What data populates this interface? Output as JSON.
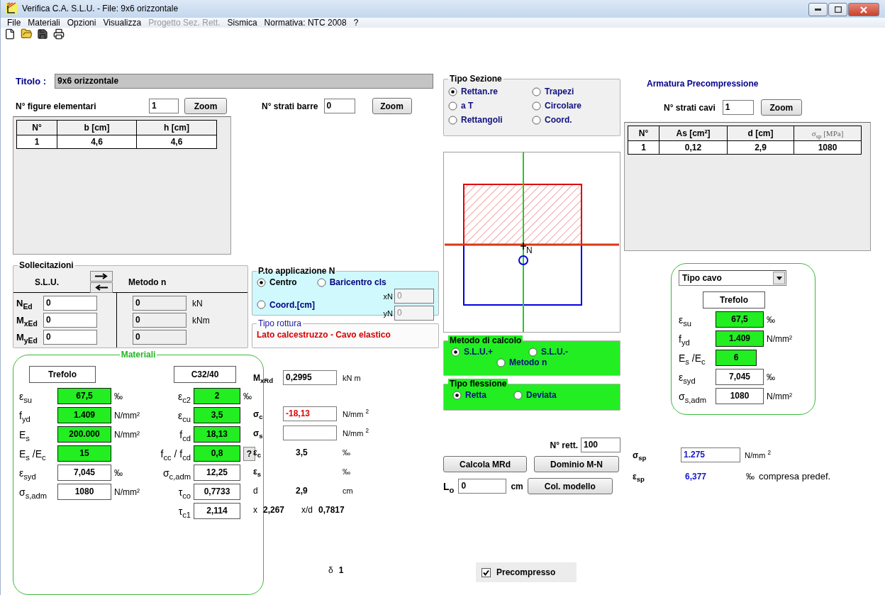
{
  "window": {
    "title": "Verifica C.A. S.L.U. - File: 9x6 orizzontale"
  },
  "menu": [
    {
      "label": "File",
      "disabled": false
    },
    {
      "label": "Materiali",
      "disabled": false
    },
    {
      "label": "Opzioni",
      "disabled": false
    },
    {
      "label": "Visualizza",
      "disabled": false
    },
    {
      "label": "Progetto Sez. Rett.",
      "disabled": true
    },
    {
      "label": "Sismica",
      "disabled": false
    },
    {
      "label": "Normativa: NTC 2008",
      "disabled": false
    },
    {
      "label": "?",
      "disabled": false
    }
  ],
  "titolo": {
    "label": "Titolo :",
    "value": "9x6 orizzontale"
  },
  "figures": {
    "label": "N° figure elementari",
    "value": "1",
    "button": "Zoom",
    "columns": [
      "N°",
      "b [cm]",
      "h [cm]"
    ],
    "rows": [
      [
        "1",
        "4,6",
        "4,6"
      ]
    ]
  },
  "bars": {
    "label": "N° strati barre",
    "value": "0",
    "button": "Zoom"
  },
  "section_type": {
    "title": "Tipo Sezione",
    "options": [
      {
        "label": "Rettan.re",
        "selected": true
      },
      {
        "label": "Trapezi",
        "selected": false
      },
      {
        "label": "a T",
        "selected": false
      },
      {
        "label": "Circolare",
        "selected": false
      },
      {
        "label": "Rettangoli",
        "selected": false
      },
      {
        "label": "Coord.",
        "selected": false
      }
    ]
  },
  "section_drawing": {
    "point_label": "N"
  },
  "prestress": {
    "title": "Armatura Precompressione",
    "label": "N° strati cavi",
    "value": "1",
    "button": "Zoom",
    "columns": [
      "N°",
      "As [cm²]",
      "d [cm]",
      "σ$_{sp}$ [MPa]"
    ],
    "rows": [
      [
        "1",
        "0,12",
        "2,9",
        "1080"
      ]
    ]
  },
  "actions": {
    "title": "Sollecitazioni",
    "left_label": "S.L.U.",
    "right_label": "Metodo n",
    "rows": [
      {
        "label": "N$_{Ed}$",
        "slu": "0",
        "n": "0",
        "unit": "kN"
      },
      {
        "label": "M$_{xEd}$",
        "slu": "0",
        "n": "0",
        "unit": "kNm"
      },
      {
        "label": "M$_{yEd}$",
        "slu": "0",
        "n": "0"
      }
    ]
  },
  "application_point": {
    "title": "P.to applicazione N",
    "options": [
      {
        "label": "Centro",
        "selected": true
      },
      {
        "label": "Baricentro cls",
        "selected": false
      },
      {
        "label": "Coord.[cm]",
        "selected": false
      }
    ],
    "coords": [
      {
        "label": "xN",
        "value": "0",
        "disabled": true
      },
      {
        "label": "yN",
        "value": "0",
        "disabled": true
      }
    ]
  },
  "failure": {
    "title": "Tipo rottura",
    "value": "Lato calcestruzzo - Cavo elastico"
  },
  "materials": {
    "title": "Materiali",
    "steel": "Trefolo",
    "concrete": "C32/40",
    "steel_rows": [
      {
        "label": "ε$_{su}$",
        "value": "67,5",
        "unit": "‰",
        "kind": "input"
      },
      {
        "label": "f$_{yd}$",
        "value": "1.409",
        "unit": "N/mm²",
        "kind": "input"
      },
      {
        "label": "E$_{s}$",
        "value": "200.000",
        "unit": "N/mm²",
        "kind": "input"
      },
      {
        "label": "E$_{s}$ /E$_{c}$",
        "value": "15",
        "kind": "input"
      },
      {
        "label": "ε$_{syd}$",
        "value": "7,045",
        "unit": "‰",
        "kind": "result"
      },
      {
        "label": "σ$_{s,adm}$",
        "value": "1080",
        "unit": "N/mm²",
        "kind": "result"
      }
    ],
    "concrete_rows": [
      {
        "label": "ε$_{c2}$",
        "value": "2",
        "unit": "‰",
        "kind": "input"
      },
      {
        "label": "ε$_{cu}$",
        "value": "3,5",
        "kind": "input"
      },
      {
        "label": "f$_{cd}$",
        "value": "18,13",
        "kind": "input"
      },
      {
        "label": "f$_{cc}$ / f$_{cd}$",
        "value": "0,8",
        "kind": "input",
        "help": "?"
      },
      {
        "label": "σ$_{c,adm}$",
        "value": "12,25",
        "kind": "result"
      },
      {
        "label": "τ$_{co}$",
        "value": "0,7733",
        "kind": "result"
      },
      {
        "label": "τ$_{c1}$",
        "value": "2,114",
        "kind": "result"
      }
    ]
  },
  "resistance": {
    "label": "M$_{xRd}$",
    "value": "0,2995",
    "unit": "kN m"
  },
  "stresses": [
    {
      "label": "σ$_{c}$",
      "value": "-18,13",
      "unit": "N/mm $^{2}$",
      "negative": true
    },
    {
      "label": "σ$_{s}$",
      "unit": "N/mm $^{2}$"
    }
  ],
  "strains": [
    {
      "label": "ε$_{c}$",
      "value": "3,5",
      "unit": "‰"
    },
    {
      "label": "ε$_{s}$",
      "unit": "‰"
    },
    {
      "label": "d",
      "value": "2,9",
      "unit": "cm"
    }
  ],
  "neutral_axis": [
    {
      "label": "x",
      "value": "2,267"
    },
    {
      "label": "x/d",
      "value": "0,7817"
    }
  ],
  "delta": {
    "label": "δ",
    "value": "1"
  },
  "method": {
    "title": "Metodo di calcolo",
    "options": [
      {
        "label": "S.L.U.+",
        "selected": true
      },
      {
        "label": "S.L.U.-",
        "selected": false
      },
      {
        "label": "Metodo n",
        "selected": false
      }
    ]
  },
  "bending": {
    "title": "Tipo flessione",
    "options": [
      {
        "label": "Retta",
        "selected": true
      },
      {
        "label": "Deviata",
        "selected": false
      }
    ]
  },
  "rectangles": {
    "label": "N° rett.",
    "value": "100"
  },
  "buttons": [
    "Calcola MRd",
    "Dominio M-N"
  ],
  "length": {
    "label": "L$_{o}$",
    "value": "0",
    "unit": "cm",
    "button": "Col. modello"
  },
  "precompresso": {
    "label": "Precompresso",
    "checked": true
  },
  "cable": {
    "selector": "Tipo cavo",
    "name": "Trefolo",
    "rows": [
      {
        "label": "ε$_{su}$",
        "value": "67,5",
        "unit": "‰",
        "kind": "input"
      },
      {
        "label": "f$_{yd}$",
        "value": "1.409",
        "unit": "N/mm²",
        "kind": "input"
      },
      {
        "label": "E$_{s}$ /E$_{c}$",
        "value": "6",
        "kind": "input"
      },
      {
        "label": "ε$_{syd}$",
        "value": "7,045",
        "unit": "‰",
        "kind": "result"
      },
      {
        "label": "σ$_{s,adm}$",
        "value": "1080",
        "unit": "N/mm²",
        "kind": "result"
      }
    ]
  },
  "prestress_stress": {
    "label": "σ$_{sp}$",
    "value": "1.275",
    "unit": "N/mm $^{2}$"
  },
  "prestress_strain": {
    "label": "ε$_{sp}$",
    "value": "6,377",
    "unit": "‰",
    "note": "compresa predef."
  }
}
